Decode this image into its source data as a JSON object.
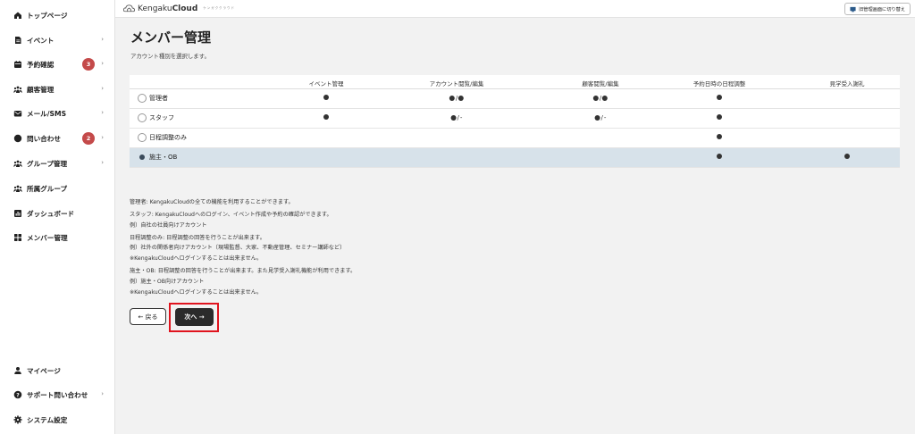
{
  "sidebar": {
    "items": [
      {
        "label": "トップページ",
        "icon": "home-icon"
      },
      {
        "label": "イベント",
        "icon": "document-icon",
        "chevron": "›"
      },
      {
        "label": "予約確認",
        "icon": "calendar-icon",
        "badge": "3",
        "chevron": "›"
      },
      {
        "label": "顧客管理",
        "icon": "users-icon",
        "chevron": "›"
      },
      {
        "label": "メール/SMS",
        "icon": "mail-icon",
        "chevron": "›"
      },
      {
        "label": "問い合わせ",
        "icon": "chat-icon",
        "badge": "2",
        "chevron": "›"
      },
      {
        "label": "グループ管理",
        "icon": "group-icon",
        "chevron": "›"
      },
      {
        "label": "所属グループ",
        "icon": "group-icon"
      },
      {
        "label": "ダッシュボード",
        "icon": "chart-icon"
      },
      {
        "label": "メンバー管理",
        "icon": "grid-icon"
      }
    ],
    "bottom": [
      {
        "label": "マイページ",
        "icon": "person-icon"
      },
      {
        "label": "サポート問い合わせ",
        "icon": "help-icon",
        "chevron": "›"
      },
      {
        "label": "システム設定",
        "icon": "gear-icon"
      }
    ]
  },
  "topbar": {
    "logo_regular": "Kengaku",
    "logo_bold": "Cloud",
    "logo_sub": "ケンガククラウド",
    "switch_label": "旧管理画面に切り替え"
  },
  "page": {
    "title": "メンバー管理",
    "subtitle": "アカウント種別を選択します。"
  },
  "table": {
    "headers": [
      "イベント管理",
      "アカウント閲覧/編集",
      "顧客閲覧/編集",
      "予約日時の日程調整",
      "見学受入謝礼"
    ],
    "rows": [
      {
        "label": "管理者",
        "selected": false,
        "cells": [
          {
            "a": true
          },
          {
            "a": true,
            "sep": "/",
            "b": true
          },
          {
            "a": true,
            "sep": "/",
            "b": true
          },
          {
            "a": true
          },
          {}
        ]
      },
      {
        "label": "スタッフ",
        "selected": false,
        "cells": [
          {
            "a": true
          },
          {
            "a": true,
            "sep": "/",
            "b_text": "-"
          },
          {
            "a": true,
            "sep": "/",
            "b_text": "-"
          },
          {
            "a": true
          },
          {}
        ]
      },
      {
        "label": "日程調整のみ",
        "selected": false,
        "cells": [
          {},
          {},
          {},
          {
            "a": true
          },
          {}
        ]
      },
      {
        "label": "施主・OB",
        "selected": true,
        "cells": [
          {},
          {},
          {},
          {
            "a": true
          },
          {
            "a": true
          }
        ]
      }
    ]
  },
  "description": [
    "管理者: KengakuCloudの全ての機能を利用することができます。",
    "スタッフ: KengakuCloudへのログイン、イベント作成や予約の確認ができます。",
    "例）自社の社員向けアカウント",
    "日程調整のみ: 日程調整の回答を行うことが出来ます。",
    "例）社外の関係者向けアカウント（現場監督、大家、不動産管理、セミナー講師など）",
    "※KengakuCloudへログインすることは出来ません。",
    "施主・OB: 日程調整の回答を行うことが出来ます。また見学受入謝礼機能が利用できます。",
    "例）施主・OB向けアカウント",
    "※KengakuCloudへログインすることは出来ません。"
  ],
  "buttons": {
    "back": "← 戻る",
    "next": "次へ →"
  },
  "colors": {
    "selected_row": "#d7e2ea",
    "badge": "#c44a4a",
    "highlight": "#e0141e",
    "next_button": "#2b2b2b"
  }
}
